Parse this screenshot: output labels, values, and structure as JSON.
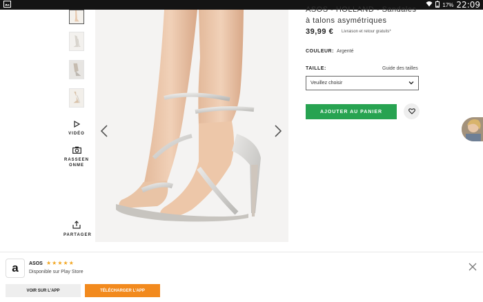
{
  "status_bar": {
    "battery": "17%",
    "time": "22:09"
  },
  "gallery": {
    "side_actions": [
      {
        "label": "VIDÉO",
        "icon": "play-icon"
      },
      {
        "label": "RASSEEN ONME",
        "icon": "camera-icon"
      },
      {
        "label": "PARTAGER",
        "icon": "share-icon"
      }
    ]
  },
  "product": {
    "title_line1": "ASOS - HOLLAND - Sandales",
    "title_line2": "à talons asymétriques",
    "price": "39,99 €",
    "price_note": "Livraison et retour gratuits*",
    "color_label": "COULEUR:",
    "color_value": "Argenté",
    "size_label": "TAILLE:",
    "size_guide": "Guide des tailles",
    "size_placeholder": "Veuillez choisir",
    "add_to_cart": "AJOUTER AU PANIER"
  },
  "app_banner": {
    "app_name": "ASOS",
    "rating": "★★★★★",
    "store_note": "Disponible sur Play Store",
    "view_label": "VOIR SUR L'APP",
    "download_label": "TÉLÉCHARGER L'APP",
    "accent": "#f28a1e"
  },
  "colors": {
    "cart_button": "#27a351",
    "status_bar": "#141414"
  }
}
